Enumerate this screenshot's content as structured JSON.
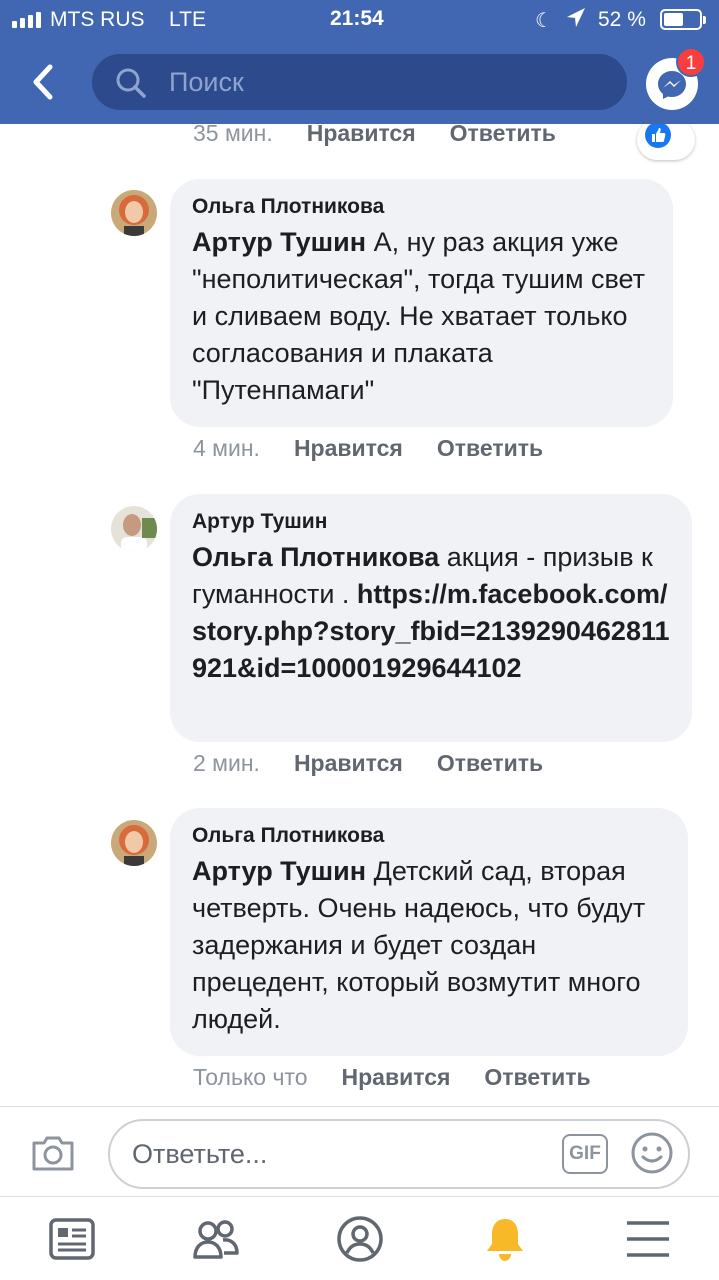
{
  "status_bar": {
    "carrier": "MTS RUS",
    "network": "LTE",
    "time": "21:54",
    "battery": "52 %",
    "battery_level": 0.52
  },
  "header": {
    "search_placeholder": "Поиск",
    "messenger_badge": "1",
    "accent_color": "#4267b2"
  },
  "previous_comment_meta": {
    "time": "35 мин.",
    "like": "Нравится",
    "reply": "Ответить"
  },
  "comments": [
    {
      "author": "Ольга Плотникова",
      "mention": "Артур Тушин",
      "text": " А, ну раз акция уже \"неполитическая\", тогда тушим свет и сливаем воду. Не хватает только согласования и плаката \"Путенпамаги\"",
      "time": "4 мин.",
      "like": "Нравится",
      "reply": "Ответить"
    },
    {
      "author": "Артур Тушин",
      "mention": "Ольга Плотникова",
      "text": " акция - призыв к гуманности . ",
      "link": "https://m.facebook.com/story.php?story_fbid=2139290462811921&id=100001929644102",
      "time": "2 мин.",
      "like": "Нравится",
      "reply": "Ответить"
    },
    {
      "author": "Ольга Плотникова",
      "mention": "Артур Тушин",
      "text": " Детский сад, вторая четверть. Очень надеюсь, что будут задержания и будет создан прецедент, который возмутит много людей.",
      "time": "Только что",
      "like": "Нравится",
      "reply": "Ответить"
    }
  ],
  "composer": {
    "placeholder": "Ответьте...",
    "gif_label": "GIF"
  },
  "tabbar": {
    "icons": [
      "news-feed-icon",
      "friends-icon",
      "profile-icon",
      "notifications-bell-icon",
      "menu-icon"
    ],
    "active": "notifications-bell-icon",
    "active_color": "#f7b928"
  }
}
